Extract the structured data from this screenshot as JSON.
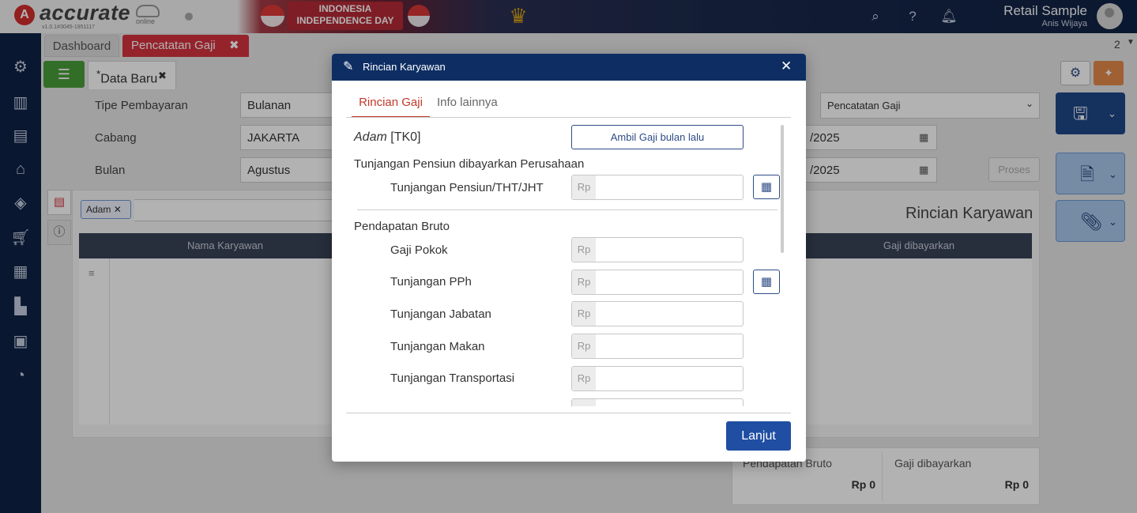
{
  "app": {
    "logo_text": "accurate",
    "logo_sub": "online",
    "version": "v1.0.1#3045-1951117",
    "banner_line1": "INDONESIA",
    "banner_line2": "INDEPENDENCE DAY",
    "company": "Retail Sample",
    "user": "Anis Wijaya"
  },
  "tabs": {
    "dashboard": "Dashboard",
    "pencatatan": "Pencatatan Gaji",
    "count": "2"
  },
  "subtab": {
    "label": "Data Baru"
  },
  "form": {
    "tipe_label": "Tipe Pembayaran",
    "tipe_value": "Bulanan",
    "cabang_label": "Cabang",
    "cabang_value": "JAKARTA",
    "bulan_label": "Bulan",
    "bulan_value": "Agustus",
    "type_select": "Pencatatan Gaji",
    "date1": "/2025",
    "date2": "/2025",
    "proses": "Proses"
  },
  "panel": {
    "chip": "Adam",
    "title": "Rincian Karyawan",
    "col_nama": "Nama Karyawan",
    "col_gaji": "Gaji dibayarkan"
  },
  "totals": {
    "bruto_label": "Pendapatan Bruto",
    "bruto_value": "Rp 0",
    "gaji_label": "Gaji dibayarkan",
    "gaji_value": "Rp 0"
  },
  "modal": {
    "title": "Rincian Karyawan",
    "tab_rincian": "Rincian Gaji",
    "tab_info": "Info lainnya",
    "employee_name": "Adam",
    "employee_code": "[TK0]",
    "ambil_button": "Ambil Gaji bulan lalu",
    "section_pensiun": "Tunjangan Pensiun dibayarkan Perusahaan",
    "section_bruto": "Pendapatan Bruto",
    "currency": "Rp",
    "fields": {
      "pensiun": "Tunjangan Pensiun/THT/JHT",
      "gaji_pokok": "Gaji Pokok",
      "pph": "Tunjangan PPh",
      "jabatan": "Tunjangan Jabatan",
      "makan": "Tunjangan Makan",
      "transport": "Tunjangan Transportasi"
    },
    "lanjut_button": "Lanjut"
  },
  "icons": {
    "accent_red": "#d6333f",
    "navy": "#0e2245",
    "button_blue": "#1f4ea3"
  }
}
